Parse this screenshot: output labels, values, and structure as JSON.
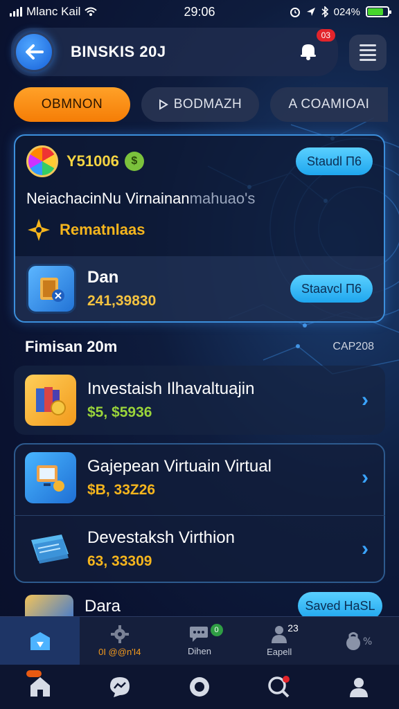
{
  "status_bar": {
    "carrier": "Mlanc Kail",
    "time": "29:06",
    "battery_text": "024%",
    "battery_level": 0.8
  },
  "header": {
    "title": "BINSKIS 20J",
    "notification_count": "03"
  },
  "tabs": [
    {
      "label": "OBMNON",
      "active": true
    },
    {
      "label": "BODMAZH",
      "active": false
    },
    {
      "label": "A COAMIOAI",
      "active": false
    }
  ],
  "featured": {
    "amount": "Y51006",
    "headline_main": "NeiachacinNu Virnainan",
    "headline_dim": "mahuao's",
    "reward_label": "Rematnlaas",
    "button_top": "Staudl П6",
    "sub_title": "Dan",
    "sub_value": "241,39830",
    "button_sub": "Staavcl П6"
  },
  "section": {
    "title": "Fimisan 20m",
    "right_label": "CAP208"
  },
  "list": [
    {
      "title": "Investaish Ilhavaltuajin",
      "value": "$5, $5936",
      "value_color": "#9ad43a"
    },
    {
      "title": "Gajepean Virtuain Virtual",
      "value": "$B, 33Z26",
      "value_color": "#f5b51d"
    },
    {
      "title": "Devestaksh Virthion",
      "value": "63, 33309",
      "value_color": "#f5b51d"
    },
    {
      "title": "Dara"
    }
  ],
  "saved_button": "Saved HaSL",
  "tabbar": [
    {
      "label": "",
      "icon": "store-icon"
    },
    {
      "label": "0I @@n'I4",
      "icon": "gear-icon"
    },
    {
      "label": "Dihen",
      "icon": "chat-icon",
      "badge": "0"
    },
    {
      "label": "Eapell",
      "icon": "person-icon",
      "badge_text": "23"
    },
    {
      "label": "",
      "icon": "lock-percent-icon"
    }
  ],
  "bottom_nav": [
    "home-icon",
    "messenger-icon",
    "circle-icon",
    "search-chat-icon",
    "profile-icon"
  ],
  "colors": {
    "accent_orange": "#f57d06",
    "accent_blue": "#1fa6ee",
    "background": "#0e1c3d"
  }
}
